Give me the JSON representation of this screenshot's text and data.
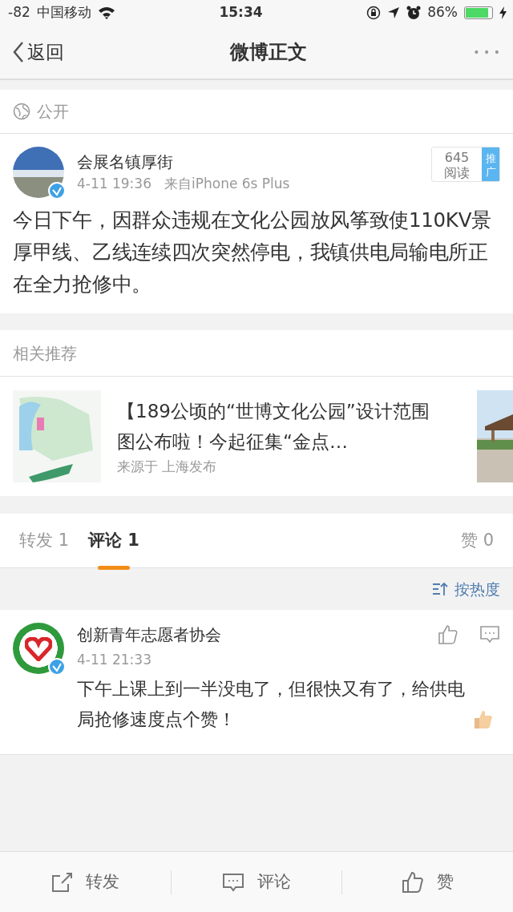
{
  "status_bar": {
    "signal": "-82",
    "carrier": "中国移动",
    "time": "15:34",
    "battery": "86%"
  },
  "nav": {
    "back": "返回",
    "title": "微博正文",
    "more": "• • •"
  },
  "visibility": "公开",
  "post": {
    "author": "会展名镇厚街",
    "verified": true,
    "time": "4-11 19:36",
    "source": "来自iPhone 6s Plus",
    "reads": "645",
    "reads_label": "阅读",
    "promote": "推广",
    "text": "今日下午，因群众违规在文化公园放风筝致使110KV景厚甲线、乙线连续四次突然停电，我镇供电局输电所正在全力抢修中。"
  },
  "related": {
    "heading": "相关推荐",
    "title": "【189公顷的“世博文化公园”设计范围图公布啦！今起征集“金点…",
    "source": "来源于 上海发布"
  },
  "tabs": [
    {
      "label": "转发 1",
      "selected": false
    },
    {
      "label": "评论 1",
      "selected": true
    },
    {
      "label": "赞 0",
      "selected": false
    }
  ],
  "sort": "按热度",
  "comments": [
    {
      "author": "创新青年志愿者协会",
      "verified": true,
      "time": "4-11 21:33",
      "text": "下午上课上到一半没电了，但很快又有了，给供电局抢修速度点个赞！"
    }
  ],
  "actions": [
    {
      "kind": "share",
      "label": "转发"
    },
    {
      "kind": "comment",
      "label": "评论"
    },
    {
      "kind": "like",
      "label": "赞"
    }
  ]
}
